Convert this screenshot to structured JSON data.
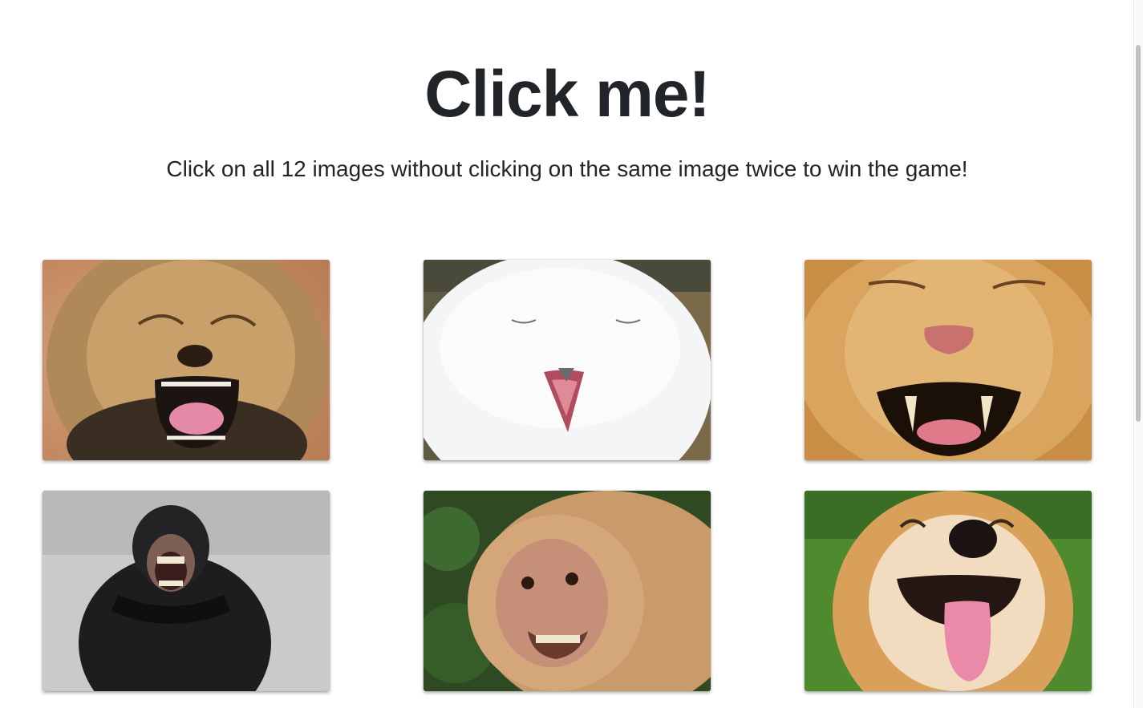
{
  "header": {
    "title": "Click me!",
    "subtitle": "Click on all 12 images without clicking on the same image twice to win the game!"
  },
  "cards": [
    {
      "name": "laughing-lion-cub-image"
    },
    {
      "name": "smiling-white-owl-image"
    },
    {
      "name": "grinning-lion-image"
    },
    {
      "name": "laughing-chimpanzee-image"
    },
    {
      "name": "smiling-monkey-image"
    },
    {
      "name": "smiling-shiba-dog-image"
    }
  ],
  "colors": {
    "text": "#212529",
    "background": "#ffffff"
  }
}
